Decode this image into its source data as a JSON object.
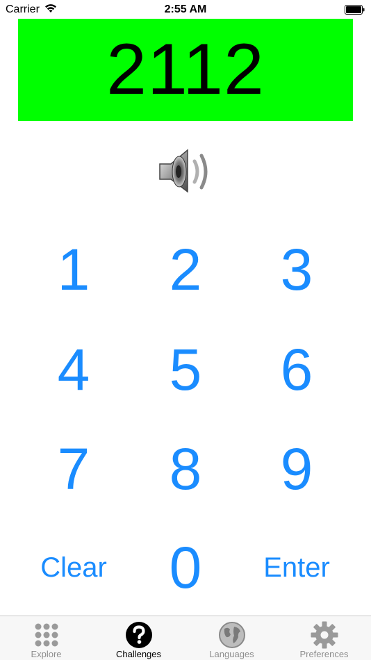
{
  "status_bar": {
    "carrier": "Carrier",
    "time": "2:55 AM"
  },
  "display": {
    "value": "2112",
    "background": "#00ff00"
  },
  "speaker": {
    "icon": "speaker-icon"
  },
  "keypad": {
    "keys": [
      "1",
      "2",
      "3",
      "4",
      "5",
      "6",
      "7",
      "8",
      "9",
      "0"
    ],
    "clear_label": "Clear",
    "enter_label": "Enter",
    "color": "#1a8cff"
  },
  "tab_bar": {
    "selected": "Challenges",
    "tabs": [
      {
        "label": "Explore",
        "icon": "grid-icon"
      },
      {
        "label": "Challenges",
        "icon": "question-icon"
      },
      {
        "label": "Languages",
        "icon": "globe-icon"
      },
      {
        "label": "Preferences",
        "icon": "gear-icon"
      }
    ]
  }
}
